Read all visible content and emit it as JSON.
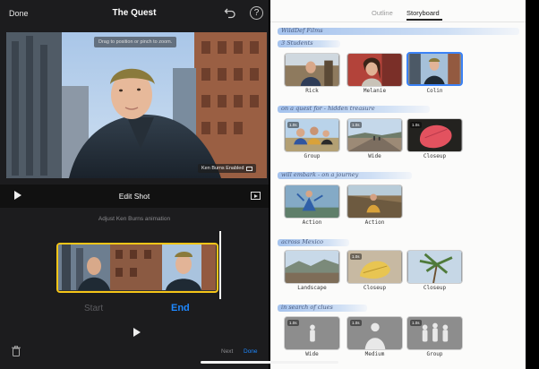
{
  "editor": {
    "done": "Done",
    "title": "The Quest",
    "help": "?",
    "hint": "Drag to position or pinch to zoom.",
    "ken_burns_badge": "Ken Burns Enabled",
    "edit_shot": "Edit Shot",
    "adjust_label": "Adjust Ken Burns animation",
    "start_label": "Start",
    "end_label": "End",
    "next": "Next",
    "done_bottom": "Done"
  },
  "storyboard": {
    "tabs": [
      "Outline",
      "Storyboard"
    ],
    "active_tab": "Storyboard",
    "app_title": "WildDef Films",
    "sections": [
      {
        "heading": "3 Students",
        "clips": [
          {
            "label": "Rick",
            "duration": "",
            "selected": false
          },
          {
            "label": "Melanie",
            "duration": "",
            "selected": false
          },
          {
            "label": "Colin",
            "duration": "",
            "selected": true
          }
        ]
      },
      {
        "heading": "on a quest for - hidden treasure",
        "clips": [
          {
            "label": "Group",
            "duration": "1.0s",
            "selected": false
          },
          {
            "label": "Wide",
            "duration": "1.0s",
            "selected": false
          },
          {
            "label": "Closeup",
            "duration": "1.0s",
            "selected": false
          }
        ]
      },
      {
        "heading": "will embark - on a journey",
        "clips": [
          {
            "label": "Action",
            "duration": "",
            "selected": false
          },
          {
            "label": "Action",
            "duration": "",
            "selected": false
          }
        ]
      },
      {
        "heading": "across Mexico",
        "clips": [
          {
            "label": "Landscape",
            "duration": "",
            "selected": false
          },
          {
            "label": "Closeup",
            "duration": "1.0s",
            "selected": false
          },
          {
            "label": "Closeup",
            "duration": "",
            "selected": false
          }
        ]
      },
      {
        "heading": "in search of clues",
        "clips": [
          {
            "label": "Wide",
            "duration": "1.0s",
            "selected": false
          },
          {
            "label": "Medium",
            "duration": "1.0s",
            "selected": false
          },
          {
            "label": "Group",
            "duration": "1.0s",
            "selected": false
          }
        ]
      }
    ]
  },
  "colors": {
    "accent_blue": "#1e88ff",
    "timeline_border": "#f5c518",
    "heading_highlight": "#9ebbe8",
    "selected_border": "#3b82f6"
  }
}
